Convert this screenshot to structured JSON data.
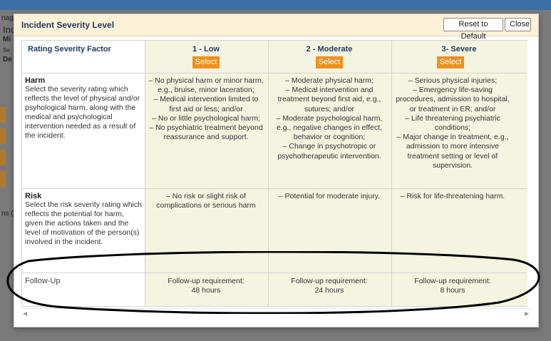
{
  "background": {
    "fragments": [
      "nager",
      "Inc",
      "Mi",
      "Se",
      "De",
      "ns ("
    ]
  },
  "dialog": {
    "title": "Incident Severity Level",
    "reset_label": "Reset to Default",
    "close_label": "Close"
  },
  "table": {
    "factor_header": "Rating Severity Factor",
    "levels": [
      {
        "label": "1 - Low",
        "select_label": "Select"
      },
      {
        "label": "2 - Moderate",
        "select_label": "Select"
      },
      {
        "label": "3- Severe",
        "select_label": "Select"
      }
    ],
    "rows": {
      "harm": {
        "title": "Harm",
        "description": "Select the severity rating which reflects the level of physical and/or psyhological harm, along with the medical and psychological intervention needed as a result of the incident.",
        "cells": [
          [
            "– No physical harm or minor harm, e.g., bruise, minor laceration;",
            "– Medical intervention limited to first aid or less; and/or",
            "– No or little psychological harm;",
            "– No psychiatric treatment beyond reassurance and support."
          ],
          [
            "– Moderate physical harm;",
            "– Medical intervention and treatment beyond first aid, e.g., sutures; and/or",
            "– Moderate psychological harm, e.g., negative changes in effect, behavior or cognition;",
            "– Change in psychotropic or psychotherapeutic intervention."
          ],
          [
            "– Serious physical injuries;",
            "– Emergency life-saving procedures, admission to hospital, or treatment in ER; and/or",
            "– Life threatening psychiatric conditions;",
            "– Major change in treatment, e.g., admission to more intensive treatment setting or level of supervision."
          ]
        ]
      },
      "risk": {
        "title": "Risk",
        "description": "Select the risk severity rating which reflects the potential for harm, given the actions taken and the level of motivation of the person(s) involved in the incident.",
        "cells": [
          "– No risk or slight risk of complications or serious harm",
          "– Potential for moderate injury.",
          "– Risk for life-threatening harm."
        ]
      },
      "followup": {
        "title": "Follow-Up",
        "cells": [
          {
            "line1": "Follow-up requirement:",
            "line2": "48 hours"
          },
          {
            "line1": "Follow-up requirement:",
            "line2": "24 hours"
          },
          {
            "line1": "Follow-up requirement:",
            "line2": "8 hours"
          }
        ]
      }
    }
  },
  "colors": {
    "header_bg": "#fdf1d8",
    "title_color": "#1f3a5f",
    "select_button": "#f0901e",
    "level_column_bg": "#f4f4e0"
  }
}
